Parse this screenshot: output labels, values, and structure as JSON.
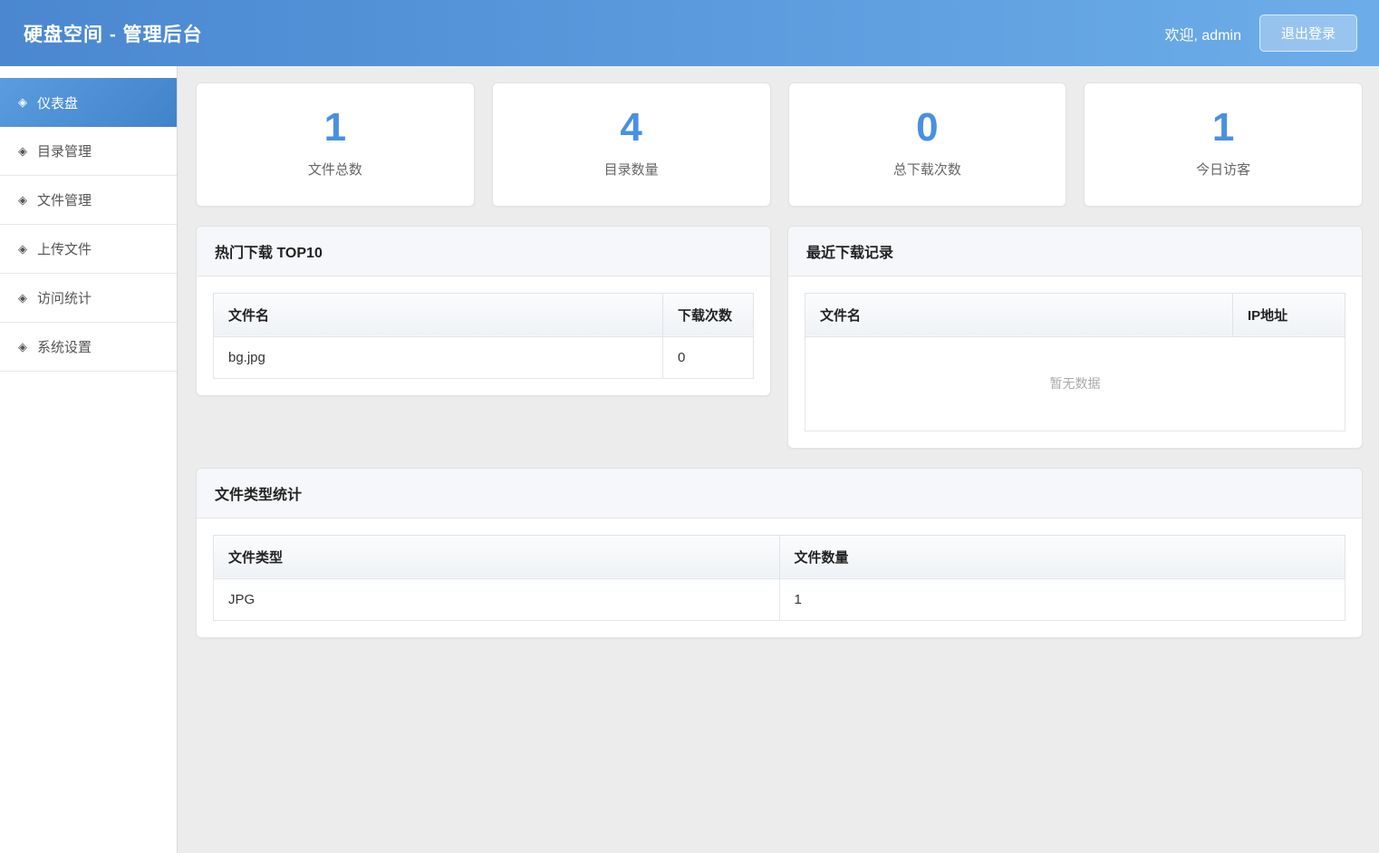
{
  "header": {
    "title": "硬盘空间 - 管理后台",
    "welcome": "欢迎, admin",
    "logout_label": "退出登录"
  },
  "sidebar": {
    "icon_glyph": "◈",
    "items": [
      {
        "label": "仪表盘",
        "active": true
      },
      {
        "label": "目录管理",
        "active": false
      },
      {
        "label": "文件管理",
        "active": false
      },
      {
        "label": "上传文件",
        "active": false
      },
      {
        "label": "访问统计",
        "active": false
      },
      {
        "label": "系统设置",
        "active": false
      }
    ]
  },
  "stats": [
    {
      "value": "1",
      "label": "文件总数"
    },
    {
      "value": "4",
      "label": "目录数量"
    },
    {
      "value": "0",
      "label": "总下载次数"
    },
    {
      "value": "1",
      "label": "今日访客"
    }
  ],
  "panels": {
    "hot_downloads": {
      "title": "热门下载 TOP10",
      "columns": [
        "文件名",
        "下载次数"
      ],
      "rows": [
        [
          "bg.jpg",
          "0"
        ]
      ]
    },
    "recent_downloads": {
      "title": "最近下载记录",
      "columns": [
        "文件名",
        "IP地址"
      ],
      "rows": [],
      "empty_text": "暂无数据"
    },
    "file_type_stats": {
      "title": "文件类型统计",
      "columns": [
        "文件类型",
        "文件数量"
      ],
      "rows": [
        [
          "JPG",
          "1"
        ]
      ]
    }
  },
  "colors": {
    "accent_blue": "#4a90e0",
    "header_gradient_start": "#4a87d0",
    "header_gradient_end": "#6cade9",
    "panel_header_bg": "#f5f7fa",
    "page_bg": "#ececec"
  }
}
